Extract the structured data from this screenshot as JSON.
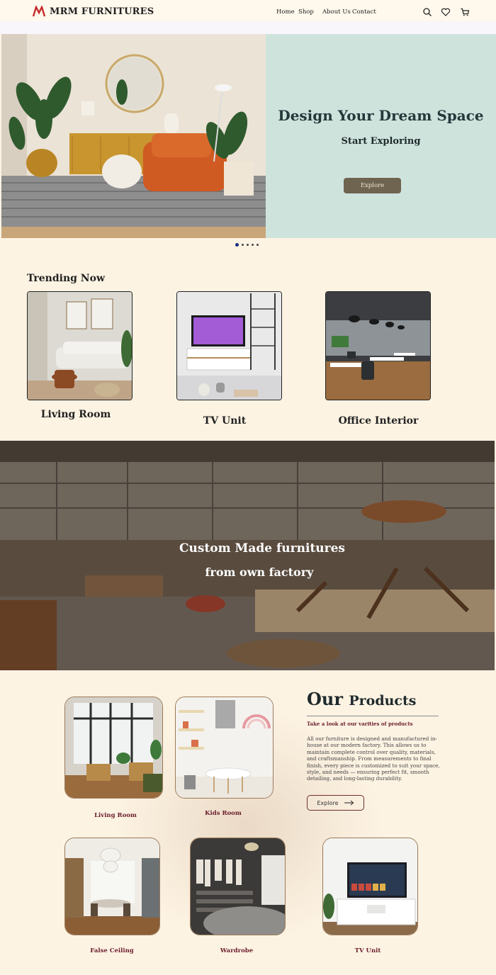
{
  "brand": {
    "name": "MRM FURNITURES",
    "accent": "#c62a2a"
  },
  "nav": {
    "home": "Home",
    "shop": "Shop",
    "about": "About Us",
    "contact": "Contact"
  },
  "icons": {
    "search": "search-icon",
    "wishlist": "heart-icon",
    "cart": "cart-icon"
  },
  "hero": {
    "title": "Design Your Dream Space",
    "subtitle": "Start Exploring",
    "button": "Explore",
    "slides_total": 5,
    "slide_active": 1
  },
  "trending": {
    "title": "Trending Now",
    "items": [
      {
        "label": "Living Room"
      },
      {
        "label": "TV Unit"
      },
      {
        "label": "Office Interior"
      }
    ]
  },
  "factory": {
    "title": "Custom Made furnitures",
    "subtitle": "from own factory"
  },
  "products": {
    "heading_big": "Our",
    "heading_rest": "Products",
    "tagline": "Take a look at our varities of products",
    "description": "All our furniture is designed and manufactured in-house at our modern factory. This allows us to maintain complete control over quality, materials, and craftsmanship. From measurements to final finish, every piece is customized to suit your space, style, and needs — ensuring perfect fit, smooth detailing, and long-lasting durability.",
    "button": "Explore",
    "items": [
      {
        "label": "Living Room"
      },
      {
        "label": "Kids Room"
      },
      {
        "label": "False Ceiling"
      },
      {
        "label": "Wardrobe"
      },
      {
        "label": "TV Unit"
      }
    ]
  }
}
